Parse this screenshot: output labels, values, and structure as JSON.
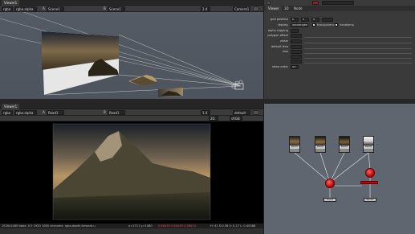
{
  "viewer_top": {
    "tab": "Viewer1",
    "toolbar": {
      "channels": "rgba",
      "layer": "rgba.alpha",
      "input_a": "A",
      "input_a_value": "Scene1",
      "input_b": "B",
      "input_b_value": "Scene1",
      "zoom": "2.4",
      "camera": "Camera1",
      "colorspace": "sRGB"
    }
  },
  "properties": {
    "tabs": [
      "Viewer",
      "3D",
      "Node"
    ],
    "rows": [
      {
        "label": "grid position",
        "values": [
          "0",
          "0",
          "0"
        ]
      },
      {
        "label": "display",
        "values": [
          "unchanged"
        ],
        "checks": [
          "transparency",
          "headlamp"
        ]
      },
      {
        "label": "alpha clipping",
        "values": [
          ""
        ]
      },
      {
        "label": "polygon offset",
        "values": [
          ""
        ]
      },
      {
        "label": "znear",
        "values": [
          ""
        ]
      },
      {
        "label": "default lens",
        "values": [
          ""
        ]
      },
      {
        "label": "size",
        "values": [
          ""
        ]
      },
      {
        "label": "",
        "values": [
          ""
        ]
      },
      {
        "label": "",
        "values": [
          ""
        ]
      },
      {
        "label": "show order",
        "values": [
          "XY"
        ]
      }
    ]
  },
  "viewer_bottom": {
    "tab": "Viewer1",
    "toolbar": {
      "channels": "rgba",
      "layer": "rgba.alpha",
      "input_a": "A",
      "input_a_value": "Read1",
      "input_b": "B",
      "input_b_value": "Read1",
      "zoom": "1.4",
      "mode": "default",
      "view": "2D",
      "colorspace": "sRGB"
    },
    "status": "1920x1080 bbox: 0 0 1920 1080 channels: rgba,depth,forward.u",
    "coords": "x=1711 y=1080",
    "rgb": "0.88430 0.60439 0.36024",
    "coords2": "H: 41 S:0.36 V: 0.17 L: 0.40388"
  },
  "dag": {
    "nodes": [
      "Read1",
      "Read2",
      "Read3",
      "Read4"
    ],
    "outputs": [
      "Scene",
      "Render"
    ]
  },
  "colors": {
    "accent": "#d30000",
    "bg": "#2f2f2f",
    "dag_bg": "#5f6670"
  }
}
